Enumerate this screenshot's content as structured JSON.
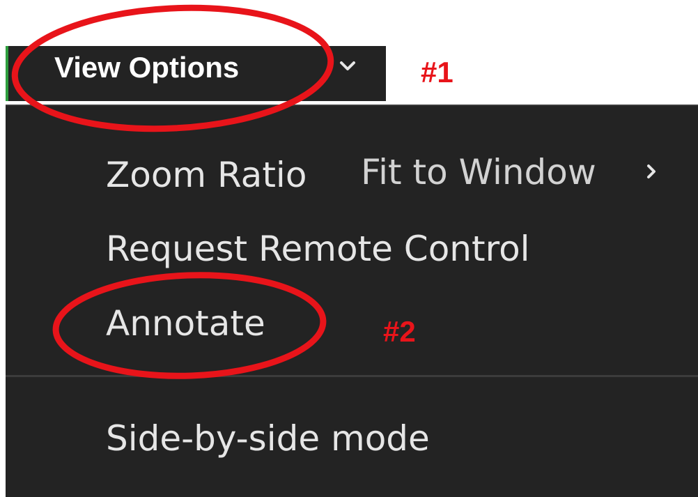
{
  "toolbar": {
    "view_options_label": "View Options"
  },
  "menu": {
    "zoom_ratio_label": "Zoom Ratio",
    "zoom_ratio_value": "Fit to Window",
    "request_remote_control_label": "Request Remote Control",
    "annotate_label": "Annotate",
    "side_by_side_label": "Side-by-side mode"
  },
  "annotations": {
    "step1": "#1",
    "step2": "#2",
    "circle_color": "#e8141a"
  },
  "colors": {
    "menu_background": "#232323",
    "menu_text": "#e6e6e6",
    "accent": "#2e9e3e"
  }
}
